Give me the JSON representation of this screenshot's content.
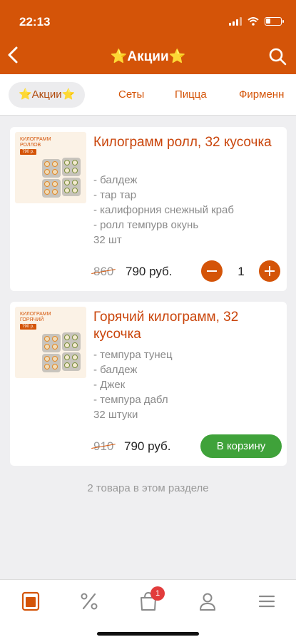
{
  "status_bar": {
    "time": "22:13"
  },
  "header": {
    "title": "⭐Акции⭐"
  },
  "tabs": [
    {
      "label": "⭐Акции⭐",
      "active": true
    },
    {
      "label": "Сеты",
      "active": false
    },
    {
      "label": "Пицца",
      "active": false
    },
    {
      "label": "Фирменн",
      "active": false
    }
  ],
  "products": [
    {
      "image_caption": "КИЛОГРАММ РОЛЛОВ",
      "image_price": "790 р.",
      "name": "Килограмм ролл, 32 кусочка",
      "description": [
        "- балдеж",
        "- тар тар",
        "- калифорния снежный краб",
        "- ролл темпурв окунь",
        "32 шт"
      ],
      "old_price": "860",
      "price": "790 руб.",
      "quantity": "1"
    },
    {
      "image_caption": "КИЛОГРАММ ГОРЯЧИЙ",
      "image_price": "790 р.",
      "name": "Горячий килограмм, 32 кусочка",
      "description": [
        "- темпура тунец",
        "- балдеж",
        "- Джек",
        "- темпура дабл",
        "32 штуки"
      ],
      "old_price": "910",
      "price": "790 руб.",
      "cart_button": "В корзину"
    }
  ],
  "section_count": "2 товара в этом разделе",
  "bottom_nav": {
    "cart_badge": "1"
  },
  "colors": {
    "accent": "#d45408",
    "title": "#c9440a",
    "cart_button": "#3fa23a",
    "badge": "#e23c3c"
  }
}
